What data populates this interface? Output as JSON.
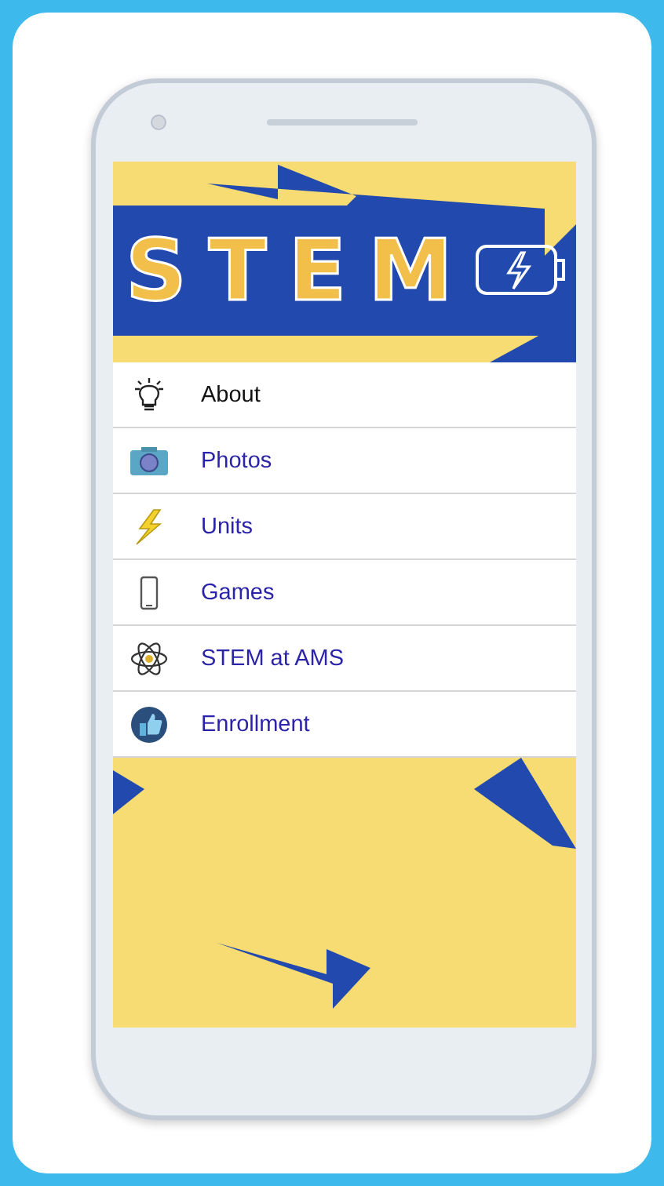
{
  "header": {
    "logo": "STEM"
  },
  "menu": [
    {
      "label": "About",
      "selected": true
    },
    {
      "label": "Photos",
      "selected": false
    },
    {
      "label": "Units",
      "selected": false
    },
    {
      "label": "Games",
      "selected": false
    },
    {
      "label": "STEM at AMS",
      "selected": false
    },
    {
      "label": "Enrollment",
      "selected": false
    }
  ]
}
